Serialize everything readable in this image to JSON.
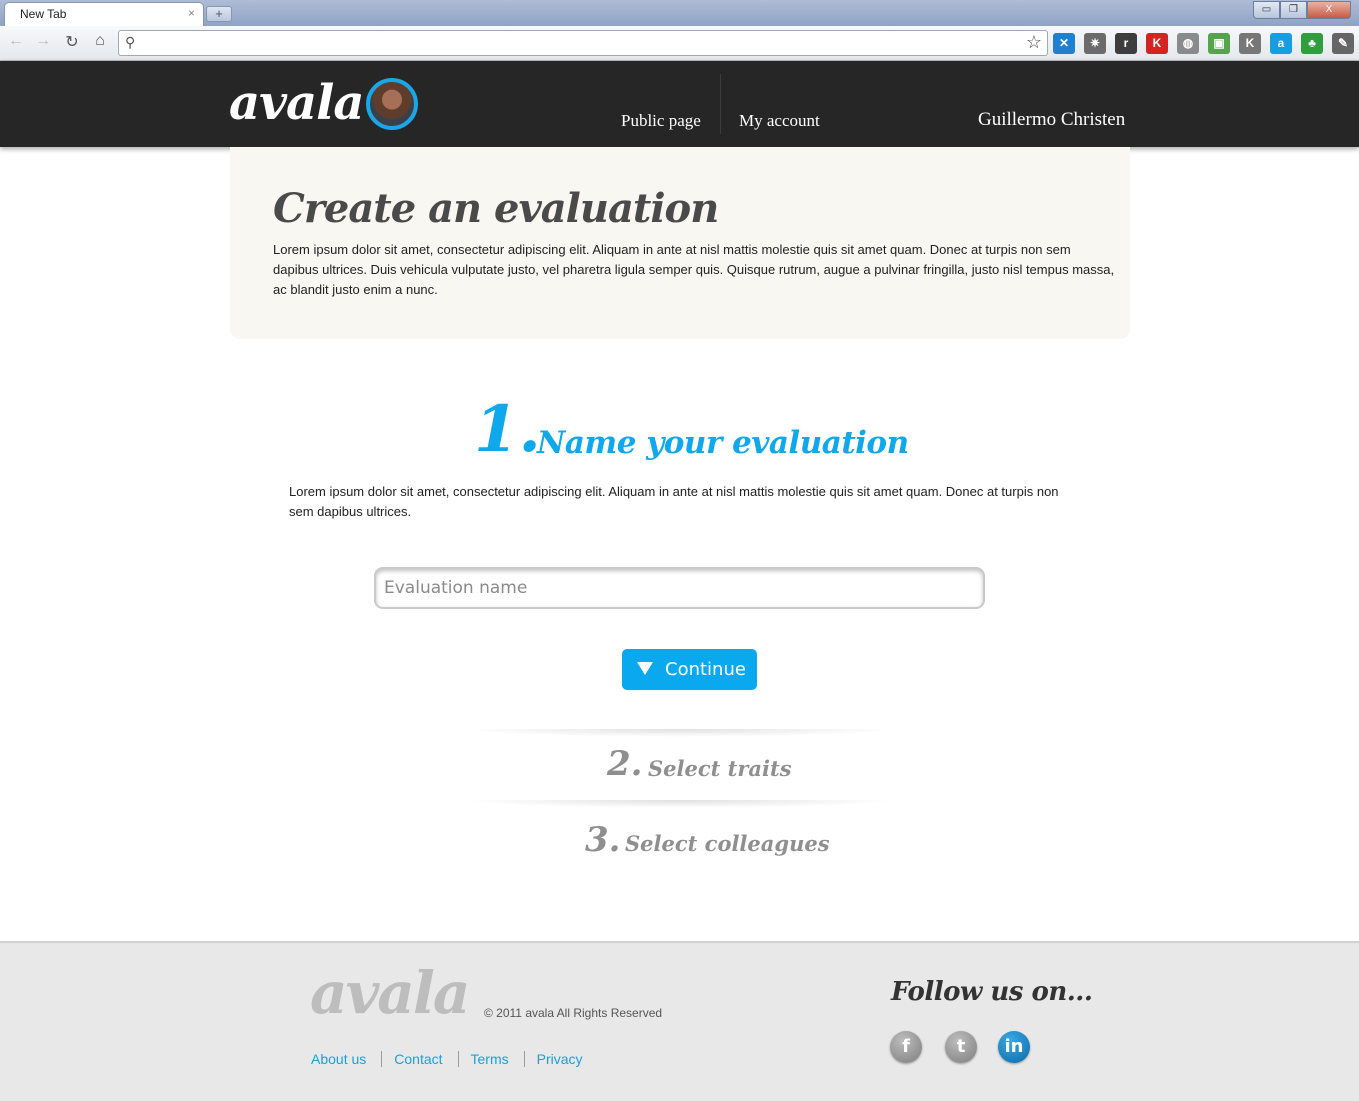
{
  "browser": {
    "tab_title": "New Tab",
    "tab_close": "×",
    "new_tab": "+",
    "address_value": "",
    "window_controls": {
      "minimize": "▭",
      "restore": "❐",
      "close": "X"
    },
    "nav": {
      "back": "←",
      "forward": "→",
      "reload": "↻",
      "home": "⌂"
    },
    "extensions": [
      {
        "icon": "x-extension-icon",
        "glyph": "✕",
        "color": "#1f7fd0"
      },
      {
        "icon": "gear-extension-icon",
        "glyph": "✷",
        "color": "#6b6b6b"
      },
      {
        "icon": "reader-extension-icon",
        "glyph": "r",
        "color": "#3d3d3d"
      },
      {
        "icon": "k-red-extension-icon",
        "glyph": "K",
        "color": "#d42323"
      },
      {
        "icon": "power-extension-icon",
        "glyph": "◍",
        "color": "#8a8a8a"
      },
      {
        "icon": "windows-extension-icon",
        "glyph": "▣",
        "color": "#58a34e"
      },
      {
        "icon": "k-extension-icon",
        "glyph": "K",
        "color": "#777777"
      },
      {
        "icon": "a-extension-icon",
        "glyph": "a",
        "color": "#1a9ce0"
      },
      {
        "icon": "leaf-extension-icon",
        "glyph": "♣",
        "color": "#2e9f3a"
      },
      {
        "icon": "wrench-icon",
        "glyph": "✎",
        "color": "#666666"
      }
    ]
  },
  "header": {
    "logo": "avala",
    "nav_public": "Public page",
    "nav_account": "My account",
    "user_name": "Guillermo Christen"
  },
  "hero": {
    "title": "Create an evaluation",
    "text": "Lorem ipsum dolor sit amet, consectetur adipiscing elit. Aliquam in ante at nisl mattis molestie quis sit amet quam. Donec at turpis non sem dapibus ultrices. Duis vehicula vulputate justo, vel pharetra ligula semper quis. Quisque rutrum, augue a pulvinar fringilla, justo nisl tempus massa, ac blandit justo enim a nunc."
  },
  "step1": {
    "number": "1.",
    "title": "Name your evaluation",
    "text": "Lorem ipsum dolor sit amet, consectetur adipiscing elit. Aliquam in ante at nisl mattis molestie quis sit amet quam. Donec at turpis non sem dapibus ultrices.",
    "input_value": "",
    "input_placeholder": "Evaluation name",
    "button_label": "Continue"
  },
  "step2": {
    "number": "2.",
    "title": "Select traits"
  },
  "step3": {
    "number": "3.",
    "title": "Select colleagues"
  },
  "footer": {
    "logo": "avala",
    "copyright": "© 2011 avala All Rights Reserved",
    "links": [
      "About us",
      "Contact",
      "Terms",
      "Privacy"
    ],
    "follow_title": "Follow us on...",
    "social": [
      {
        "name": "facebook",
        "glyph": "f"
      },
      {
        "name": "twitter",
        "glyph": "t"
      },
      {
        "name": "linkedin",
        "glyph": "in"
      }
    ]
  },
  "colors": {
    "accent": "#0fa8ec",
    "header_bg": "#262626",
    "hero_bg": "#f9f7f1",
    "footer_bg": "#e8e8e8",
    "muted_step": "#8f8f8f"
  }
}
